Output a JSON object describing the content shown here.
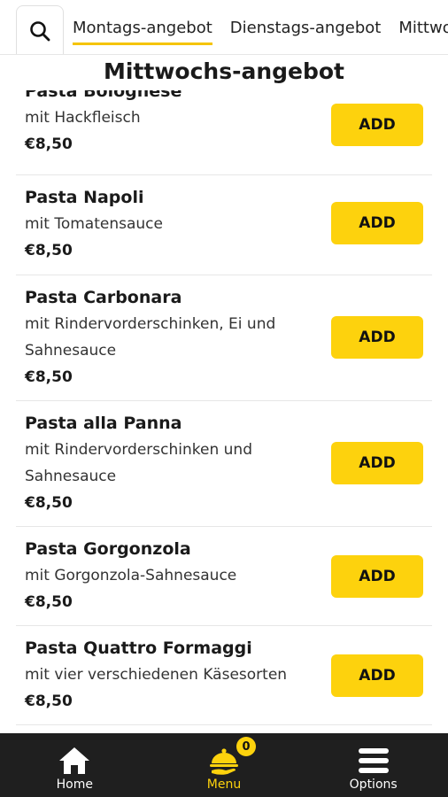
{
  "tabs": [
    {
      "label": "Montags-angebot",
      "active": true
    },
    {
      "label": "Dienstags-angebot",
      "active": false
    },
    {
      "label": "Mittwochs-angebot",
      "active": false
    }
  ],
  "section_title": "Mittwochs-angebot",
  "items": [
    {
      "name": "Pasta Bolognese",
      "desc": "mit Hackfleisch",
      "price": "€8,50",
      "button": "ADD"
    },
    {
      "name": "Pasta Napoli",
      "desc": "mit Tomatensauce",
      "price": "€8,50",
      "button": "ADD"
    },
    {
      "name": "Pasta Carbonara",
      "desc": "mit Rindervorderschinken, Ei und Sahnesauce",
      "price": "€8,50",
      "button": "ADD"
    },
    {
      "name": "Pasta alla Panna",
      "desc": "mit Rindervorderschinken und Sahnesauce",
      "price": "€8,50",
      "button": "ADD"
    },
    {
      "name": "Pasta Gorgonzola",
      "desc": "mit Gorgonzola-Sahnesauce",
      "price": "€8,50",
      "button": "ADD"
    },
    {
      "name": "Pasta Quattro Formaggi",
      "desc": "mit vier verschiedenen Käsesorten",
      "price": "€8,50",
      "button": "ADD"
    }
  ],
  "bottom_nav": {
    "home": {
      "label": "Home",
      "icon": "home-icon"
    },
    "menu": {
      "label": "Menu",
      "icon": "menu-cloche-icon",
      "badge": "0",
      "active": true
    },
    "options": {
      "label": "Options",
      "icon": "hamburger-icon"
    }
  },
  "colors": {
    "accent": "#fdd20d",
    "nav_bg": "#1f1f1f",
    "divider": "#e6e6e6"
  }
}
